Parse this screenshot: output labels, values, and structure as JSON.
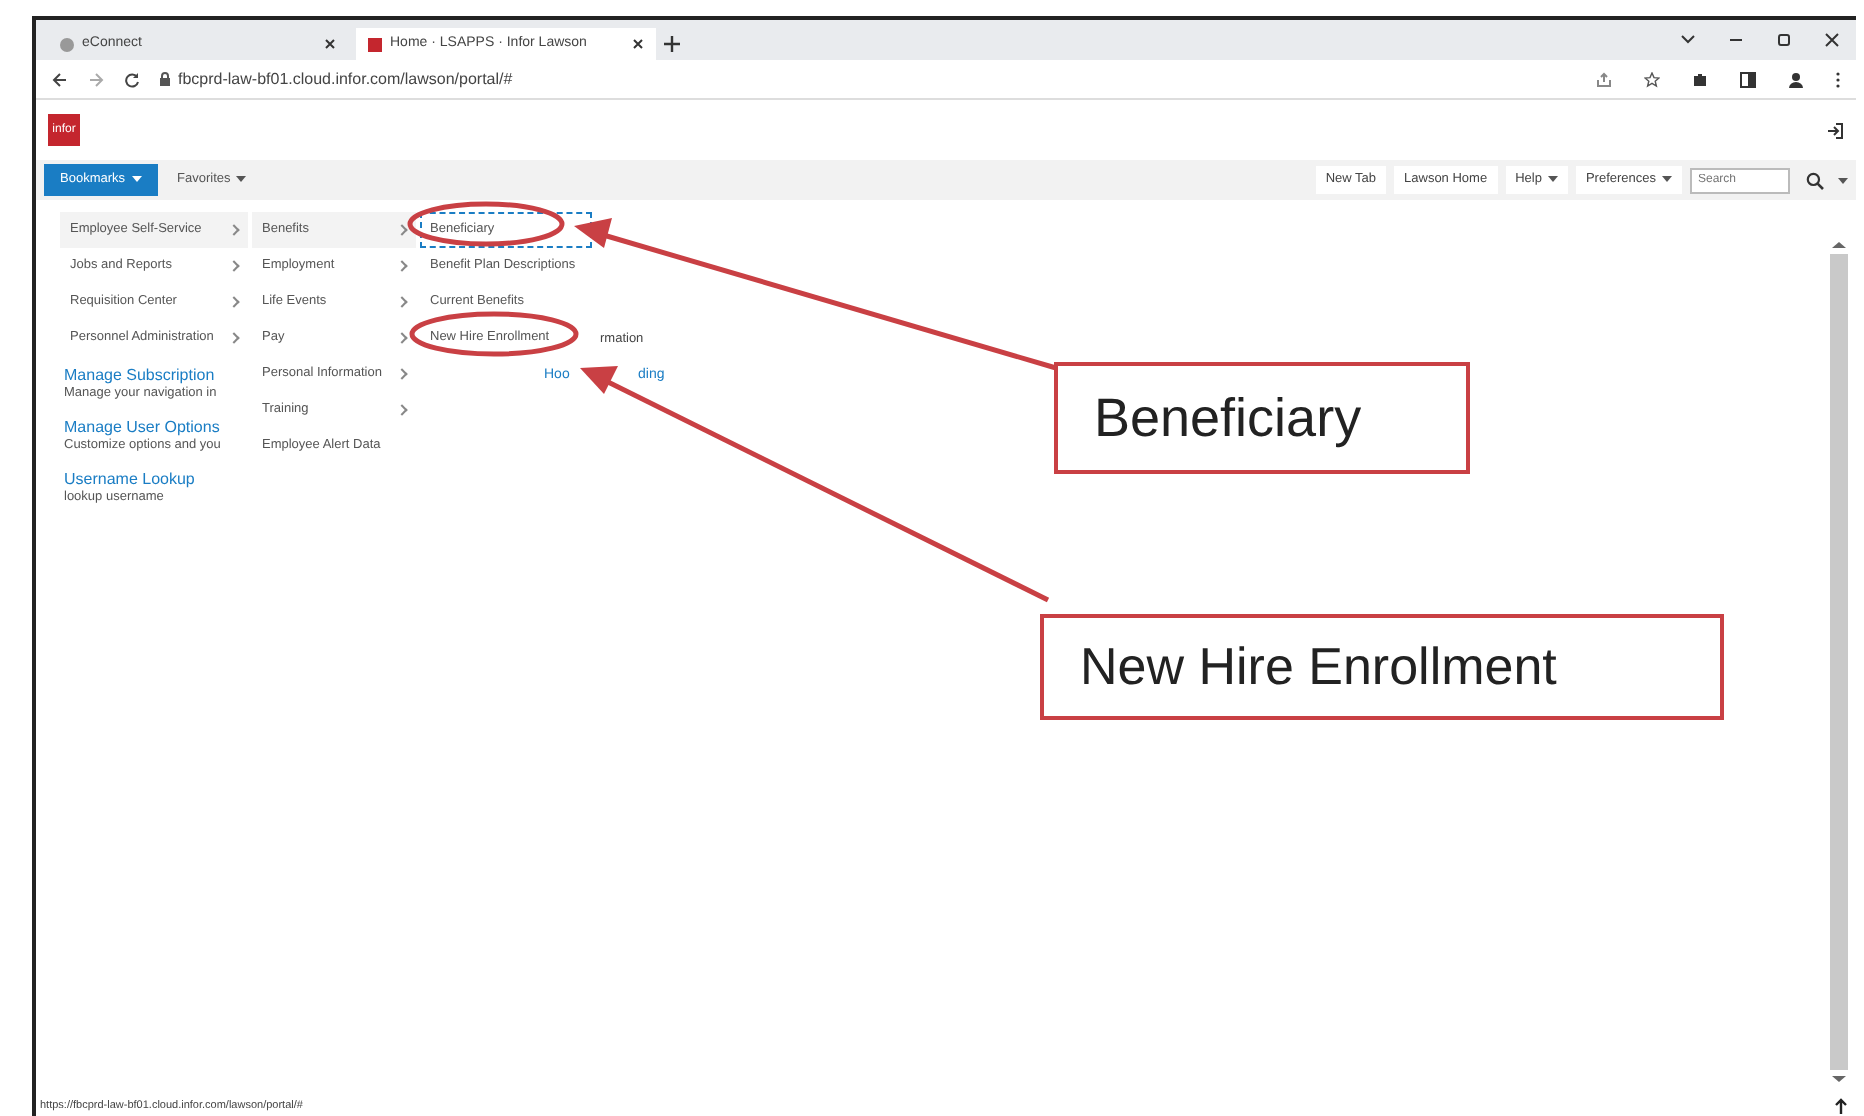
{
  "browser": {
    "tabs": [
      {
        "label": "eConnect",
        "selected": false
      },
      {
        "label": "Home · LSAPPS · Infor Lawson",
        "selected": true
      }
    ],
    "address": "fbcprd-law-bf01.cloud.infor.com/lawson/portal/#",
    "status_url": "https://fbcprd-law-bf01.cloud.infor.com/lawson/portal/#"
  },
  "app": {
    "logo": "infor",
    "nav": [
      {
        "label": "Bookmarks",
        "selected": true
      },
      {
        "label": "Favorites",
        "selected": false
      }
    ],
    "links": [
      {
        "label": "New Tab",
        "dropdown": false
      },
      {
        "label": "Lawson Home",
        "dropdown": false
      },
      {
        "label": "Help",
        "dropdown": true
      },
      {
        "label": "Preferences",
        "dropdown": true
      }
    ],
    "search": {
      "placeholder": "Search"
    }
  },
  "menus": [
    [
      {
        "label": "Employee Self-Service",
        "submenu": true,
        "selected": true
      },
      {
        "label": "Jobs and Reports",
        "submenu": true,
        "selected": false
      },
      {
        "label": "Requisition Center",
        "submenu": true,
        "selected": false
      },
      {
        "label": "Personnel Administration",
        "submenu": true,
        "selected": false
      }
    ],
    [
      {
        "label": "Benefits",
        "submenu": true,
        "selected": true
      },
      {
        "label": "Employment",
        "submenu": true,
        "selected": false
      },
      {
        "label": "Life Events",
        "submenu": true,
        "selected": false
      },
      {
        "label": "Pay",
        "submenu": true,
        "selected": false
      },
      {
        "label": "Personal Information",
        "submenu": true,
        "selected": false
      },
      {
        "label": "Training",
        "submenu": true,
        "selected": false
      },
      {
        "label": "Employee Alert Data",
        "submenu": false,
        "selected": false
      }
    ],
    [
      {
        "label": "Beneficiary",
        "submenu": false,
        "selected": true
      },
      {
        "label": "Benefit Plan Descriptions",
        "submenu": false,
        "selected": false
      },
      {
        "label": "Current Benefits",
        "submenu": false,
        "selected": false
      },
      {
        "label": "New Hire Enrollment",
        "submenu": false,
        "selected": false
      }
    ]
  ],
  "hidden_content": {
    "text": "rmation",
    "link_start": "Hoo",
    "link_end": "ding"
  },
  "panel_links": [
    {
      "title": "Manage Subscription",
      "description": "Manage your navigation in"
    },
    {
      "title": "Manage User Options",
      "description": "Customize options and you"
    },
    {
      "title": "Username Lookup",
      "description": "lookup username"
    }
  ],
  "callouts": [
    "Beneficiary",
    "New Hire Enrollment"
  ]
}
